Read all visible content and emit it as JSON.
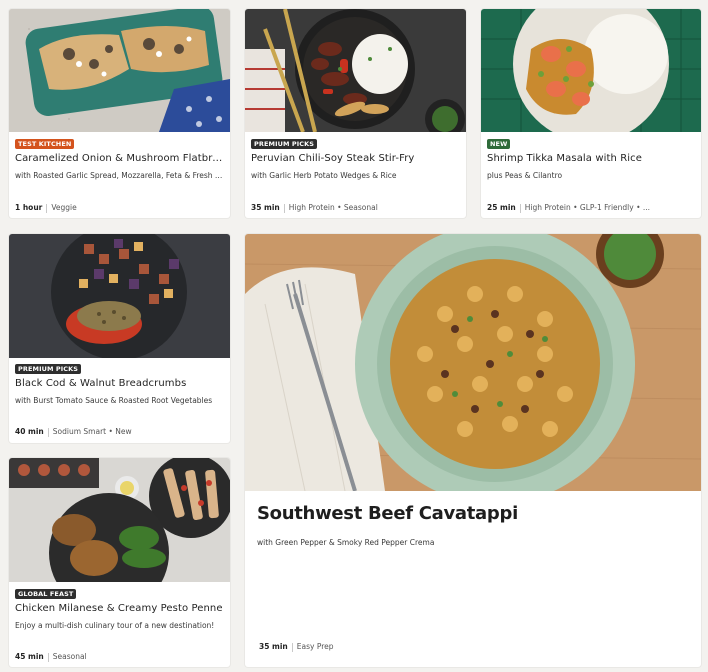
{
  "recipes": [
    {
      "badge": "TEST KITCHEN",
      "badge_color": "#d4531d",
      "title": "Caramelized Onion & Mushroom Flatbread",
      "subtitle": "with Roasted Garlic Spread, Mozzarella, Feta & Fresh Herbs",
      "time": "1 hour",
      "tags": "Veggie"
    },
    {
      "badge": "PREMIUM PICKS",
      "badge_color": "#2e2e2e",
      "title": "Peruvian Chili-Soy Steak Stir-Fry",
      "subtitle": "with Garlic Herb Potato Wedges & Rice",
      "time": "35 min",
      "tags": "High Protein • Seasonal"
    },
    {
      "badge": "NEW",
      "badge_color": "#2f6b3a",
      "title": "Shrimp Tikka Masala with Rice",
      "subtitle": "plus Peas & Cilantro",
      "time": "25 min",
      "tags": "High Protein • GLP-1 Friendly • ..."
    },
    {
      "badge": "PREMIUM PICKS",
      "badge_color": "#2e2e2e",
      "title": "Black Cod & Walnut Breadcrumbs",
      "subtitle": "with Burst Tomato Sauce & Roasted Root Vegetables",
      "time": "40 min",
      "tags": "Sodium Smart • New"
    },
    {
      "badge": "GLOBAL FEAST",
      "badge_color": "#2e2e2e",
      "title": "Chicken Milanese & Creamy Pesto Penne",
      "subtitle": "Enjoy a multi-dish culinary tour of a new destination!",
      "time": "45 min",
      "tags": "Seasonal"
    }
  ],
  "featured": {
    "title": "Southwest Beef Cavatappi",
    "subtitle": "with Green Pepper & Smoky Red Pepper Crema",
    "time": "35 min",
    "tags": "Easy Prep"
  }
}
